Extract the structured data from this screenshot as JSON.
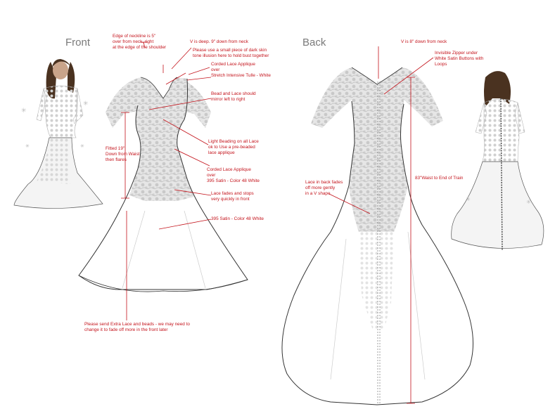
{
  "headings": {
    "front": "Front",
    "back": "Back"
  },
  "front_notes": {
    "neckline_edge": "Edge of neckline is 5\"\nover from neck, right\nat the edge of the shoulder",
    "v_depth": "V is deep. 9\" down from neck",
    "illusion": "Please use a small piece of dark skin\ntone illusion here to hold bust together",
    "corded_lace_tulle": "Corded Lace Applique\nover\nStretch Intensive Tulle - White",
    "mirror": "Bead and Lace should\nmirror left to right",
    "beading": "Light Beading on all Lace\nok to Use a pre-beaded\nlace applique",
    "fitted": "Fitted 19\"\nDown from Waist\nthen flares",
    "corded_lace_satin": "Corded Lace Applique\nover\n395 Satin - Color 48 White",
    "lace_fades": "Lace fades and stops\nvery quickly in front",
    "satin": "395 Satin - Color 48 White",
    "extra_lace": "Please send Extra Lace and beads - we may need to\nchange it to fade off more in the front later"
  },
  "back_notes": {
    "v_depth": "V is 8\" down from neck",
    "zipper": "Invisible Zipper under\nWhite Satin Buttons with\nLoops",
    "lace_back": "Lace in back fades\noff more gently\nin a V shape",
    "train": "83\"Waist to End of Train"
  },
  "colors": {
    "annotation": "#c4141c",
    "heading": "#7a7a7a",
    "sketch_line": "#3a3a3a",
    "lace": "#d4d4d4",
    "hair": "#4a3220"
  }
}
